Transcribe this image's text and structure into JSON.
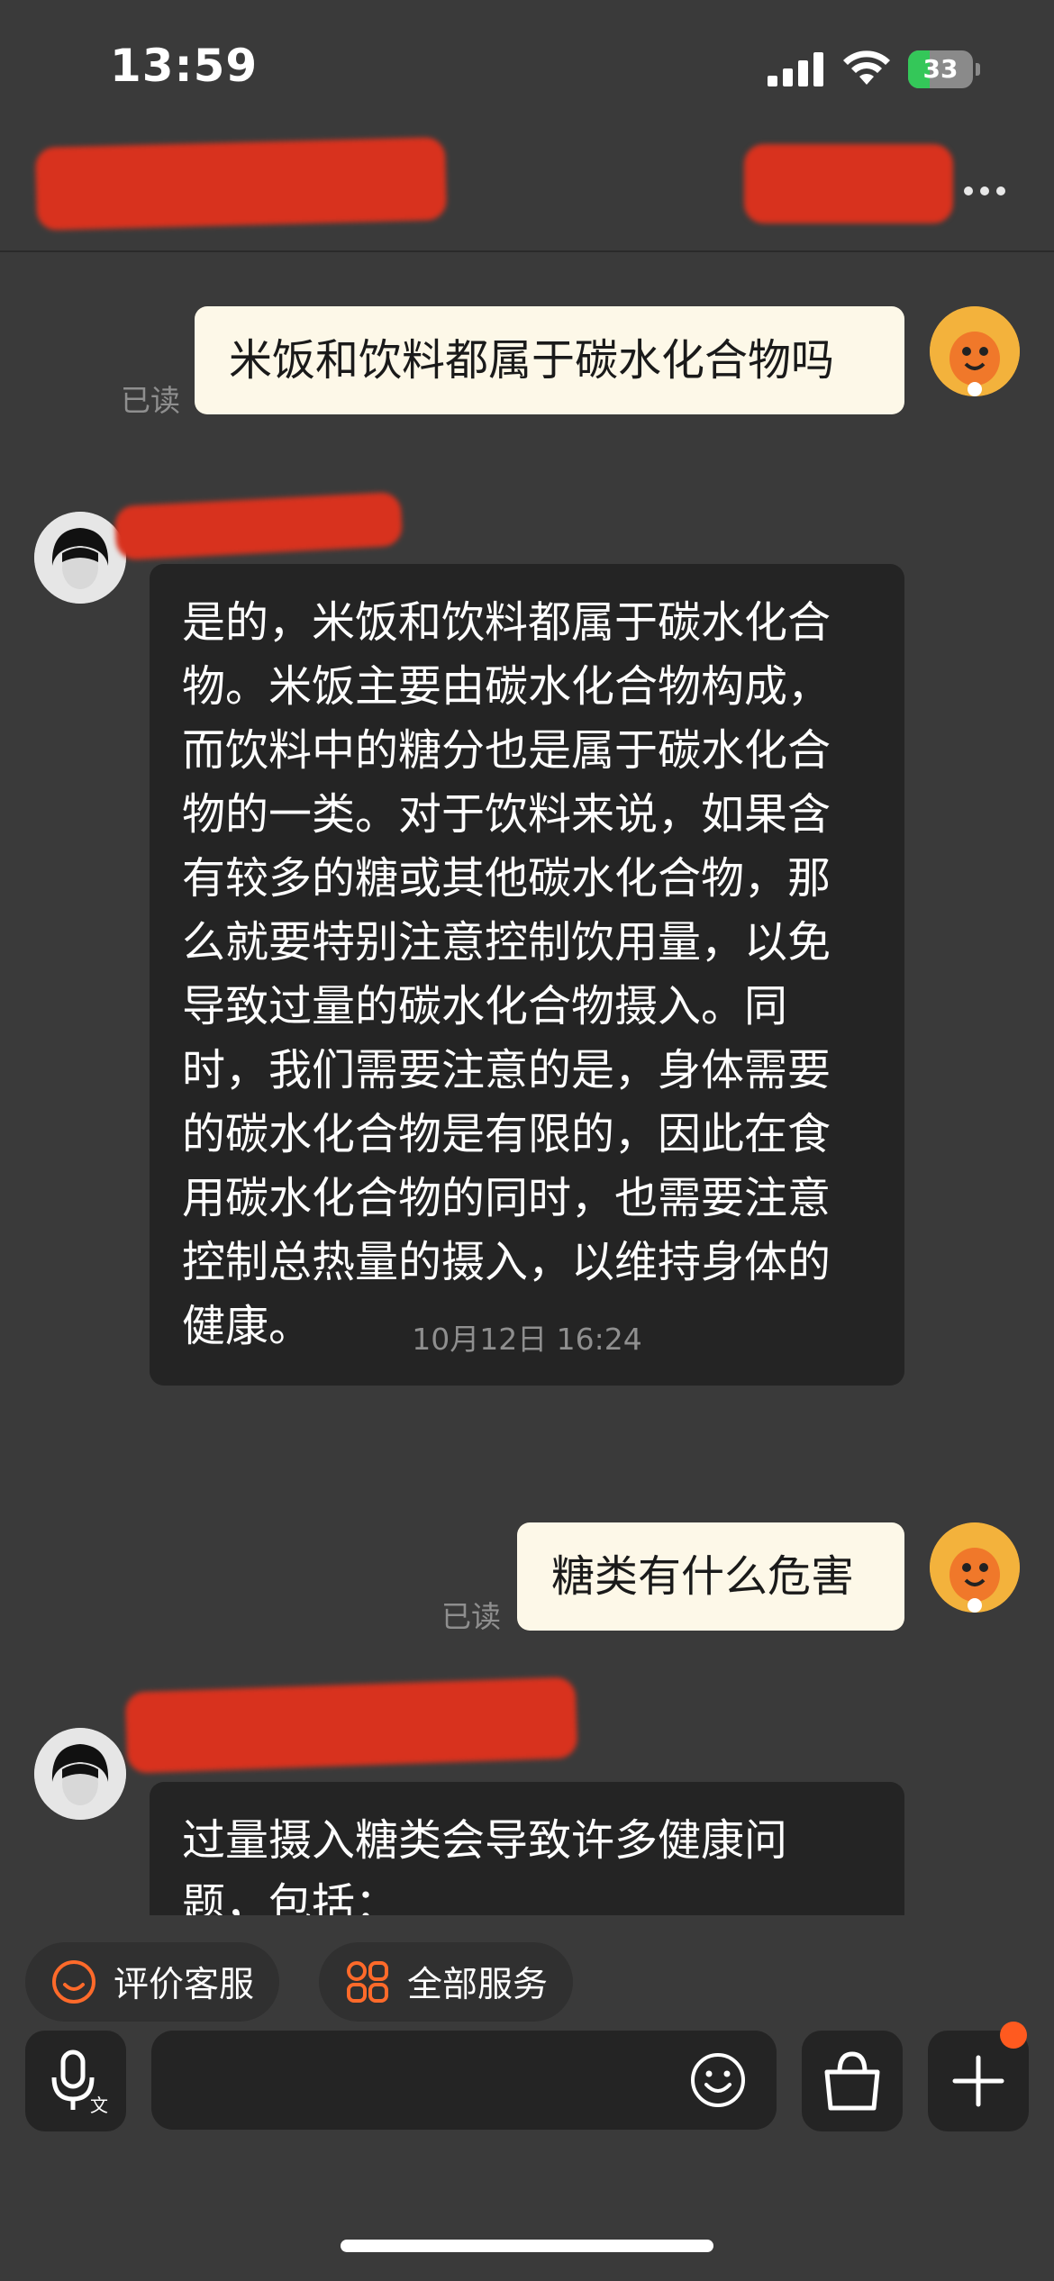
{
  "status_bar": {
    "time": "13:59",
    "battery": "33",
    "battery_level": 0.33,
    "icons": [
      "signal-icon",
      "wifi-icon",
      "battery-charging-icon"
    ]
  },
  "nav": {
    "more_icon": "more-dots-icon",
    "redaction_color": "#d8321e"
  },
  "messages": [
    {
      "type": "outgoing",
      "text": "米饭和饮料都属于碳水化合物吗",
      "read": "已读"
    },
    {
      "type": "incoming",
      "lines": [
        "是的，米饭和饮料都属于碳水化合",
        "物。米饭主要由碳水化合物构成，",
        "而饮料中的糖分也是属于碳水化合",
        "物的一类。对于饮料来说，如果含",
        "有较多的糖或其他碳水化合物，那",
        "么就要特别注意控制饮用量，以免",
        "导致过量的碳水化合物摄入。同",
        "时，我们需要注意的是，身体需要",
        "的碳水化合物是有限的，因此在食",
        "用碳水化合物的同时，也需要注意",
        "控制总热量的摄入，以维持身体的",
        "健康。"
      ]
    },
    {
      "type": "timestamp",
      "text": "10月12日 16:24"
    },
    {
      "type": "outgoing",
      "text": "糖类有什么危害",
      "read": "已读"
    },
    {
      "type": "incoming",
      "lines": [
        "过量摄入糖类会导致许多健康问",
        "题，包括："
      ]
    }
  ],
  "quick_actions": [
    {
      "label": "评价客服",
      "icon": "smiley-icon"
    },
    {
      "label": "全部服务",
      "icon": "grid-services-icon"
    }
  ],
  "input_bar": {
    "placeholder": "",
    "value": "",
    "icons": [
      "voice-input-icon",
      "emoji-icon",
      "shopping-bag-icon",
      "plus-icon"
    ]
  },
  "colors": {
    "background": "#3a3a3a",
    "outgoing_bubble": "#fdf8e8",
    "incoming_bubble": "#242424",
    "accent": "#ff5a1f"
  }
}
